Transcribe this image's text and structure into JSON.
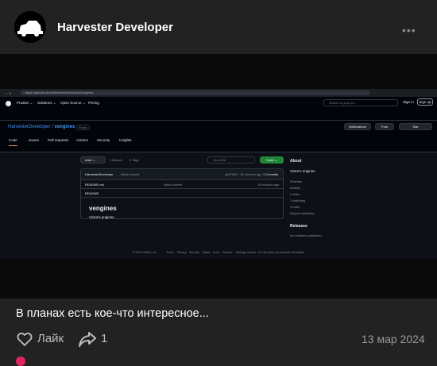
{
  "post": {
    "author": "Harvester Developer",
    "more_label": "•••",
    "caption": "В планах есть кое-что интересное...",
    "like_label": "Лайк",
    "share_count": "1",
    "date": "13 мар 2024"
  },
  "screenshot": {
    "url": "https://github.com/HarvesterDeveloper/vengines",
    "nav": [
      "Product ⌄",
      "Solutions ⌄",
      "Open Source ⌄",
      "Pricing"
    ],
    "search_placeholder": "Search or jump to...",
    "sign_in": "Sign in",
    "sign_up": "Sign up",
    "repo_owner": "HarvesterDeveloper",
    "repo_sep": " / ",
    "repo_name": "vengines",
    "repo_badge": "Public",
    "notifications": "Notifications",
    "fork": "Fork",
    "star": "Star",
    "tabs": [
      "Code",
      "Issues",
      "Pull requests",
      "Actions",
      "Security",
      "Insights"
    ],
    "branch": "main ⌄",
    "branches": "1 Branch",
    "tags": "0 Tags",
    "goto_file": "Go to file",
    "code_button": "Code ⌄",
    "commit_author": "HarvesterDeveloper",
    "commit_msg": "Initial commit",
    "commit_meta": "aa97518 · 16 minutes ago",
    "commits": "1 Commits",
    "file_name": "README.md",
    "file_msg": "Initial commit",
    "file_time": "16 minutes ago",
    "readme_tab": "README",
    "readme_title": "vengines",
    "readme_body": "Victor's engines",
    "about_title": "About",
    "about_desc": "Victor's engines",
    "about_items": [
      "Readme",
      "Activity",
      "0 stars",
      "1 watching",
      "0 forks",
      "Report repository"
    ],
    "releases_title": "Releases",
    "releases_text": "No releases published",
    "footer": [
      "© 2024 GitHub, Inc.",
      "Terms",
      "Privacy",
      "Security",
      "Status",
      "Docs",
      "Contact",
      "Manage cookies",
      "Do not share my personal information"
    ]
  },
  "colors": {
    "background": "#222222",
    "github_bg": "#0d1117",
    "github_link": "#4493f8",
    "github_green": "#238636"
  },
  "icons": [
    "avatar-harvester-icon",
    "more-dots-icon",
    "github-logo-icon",
    "heart-icon",
    "share-arrow-icon"
  ]
}
